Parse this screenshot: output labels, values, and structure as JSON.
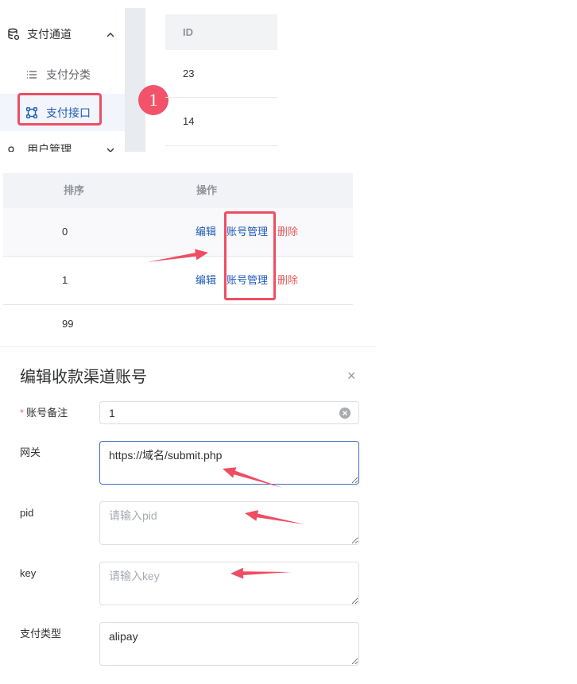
{
  "sidebar": {
    "group": {
      "label": "支付通道",
      "icon": "database-icon",
      "expanded": true
    },
    "items": [
      {
        "label": "支付分类",
        "icon": "list-icon",
        "selected": false
      },
      {
        "label": "支付接口",
        "icon": "interface-icon",
        "selected": true
      }
    ],
    "next_group": {
      "label": "用户管理",
      "icon": "circle-icon",
      "expanded": false
    }
  },
  "step_badge": "1",
  "id_table": {
    "header": "ID",
    "rows": [
      "23",
      "14"
    ]
  },
  "channel_table": {
    "headers": [
      "排序",
      "操作"
    ],
    "rows": [
      {
        "sort": "0",
        "actions": [
          "编辑",
          "账号管理",
          "删除"
        ]
      },
      {
        "sort": "1",
        "actions": [
          "编辑",
          "账号管理",
          "删除"
        ]
      }
    ],
    "partial_row_sort": "99"
  },
  "dialog": {
    "title": "编辑收款渠道账号",
    "close": "×",
    "required_mark": "*",
    "fields": [
      {
        "label": "账号备注",
        "value": "1",
        "required": true
      },
      {
        "label": "网关",
        "value": "https://域名/submit.php",
        "focused": true
      },
      {
        "label": "pid",
        "placeholder": "请输入pid"
      },
      {
        "label": "key",
        "placeholder": "请输入key"
      },
      {
        "label": "支付类型",
        "value": "alipay"
      }
    ]
  },
  "colors": {
    "accent": "#1e5bb8",
    "danger": "#e35a5a",
    "annotation": "#ef4d63",
    "required": "#f56c6c"
  }
}
